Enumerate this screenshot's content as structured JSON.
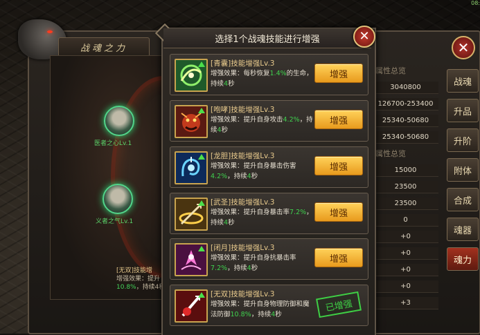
{
  "clock": "08:",
  "back_panel": {
    "title": "战魂之力",
    "skill_orbs": [
      {
        "label": "医者之心Lv.1"
      },
      {
        "label": "义者之气Lv.1"
      }
    ],
    "bg_skill": {
      "name": "[无双]技能增",
      "line1": "增强效果：提升",
      "line2_pct": "10.8%",
      "line2_rest": "，持续4秒"
    },
    "attr_header_1": "属性总览",
    "attr_values_1": [
      "3040800",
      "126700-253400",
      "25340-50680",
      "25340-50680"
    ],
    "attr_header_2": "属性总览",
    "attr_values_2": [
      "15000",
      "23500",
      "23500",
      "0",
      "+0",
      "+0",
      "+0",
      "+0",
      "+3"
    ],
    "tabs": [
      "战魂",
      "升品",
      "升阶",
      "附体",
      "合成",
      "魂器",
      "魂力"
    ],
    "active_tab": "魂力"
  },
  "dialog": {
    "title": "选择1个战魂技能进行增强",
    "button_label": "增强",
    "done_label": "已增强",
    "skills": [
      {
        "name": "[青囊]技能增强Lv.3",
        "desc_pre": "增强效果：每秒恢复",
        "desc_pct": "1.4%",
        "desc_mid": "的生命，持续",
        "desc_num": "4",
        "desc_post": "秒",
        "done": false
      },
      {
        "name": "[咆哮]技能增强Lv.3",
        "desc_pre": "增强效果：提升自身攻击",
        "desc_pct": "4.2%",
        "desc_mid": "，持续",
        "desc_num": "4",
        "desc_post": "秒",
        "done": false
      },
      {
        "name": "[龙胆]技能增强Lv.3",
        "desc_pre": "增强效果：提升自身暴击伤害",
        "desc_pct": "4.2%",
        "desc_mid": "，持续",
        "desc_num": "4",
        "desc_post": "秒",
        "done": false
      },
      {
        "name": "[武圣]技能增强Lv.3",
        "desc_pre": "增强效果：提升自身暴击率",
        "desc_pct": "7.2%",
        "desc_mid": "，持续",
        "desc_num": "4",
        "desc_post": "秒",
        "done": false
      },
      {
        "name": "[闭月]技能增强Lv.3",
        "desc_pre": "增强效果：提升自身抗暴击率",
        "desc_pct": "7.2%",
        "desc_mid": "，持续",
        "desc_num": "4",
        "desc_post": "秒",
        "done": false
      },
      {
        "name": "[无双]技能增强Lv.3",
        "desc_pre": "增强效果：提升自身物理防御和魔法防御",
        "desc_pct": "10.8%",
        "desc_mid": "，持续",
        "desc_num": "4",
        "desc_post": "秒",
        "done": true
      }
    ]
  }
}
